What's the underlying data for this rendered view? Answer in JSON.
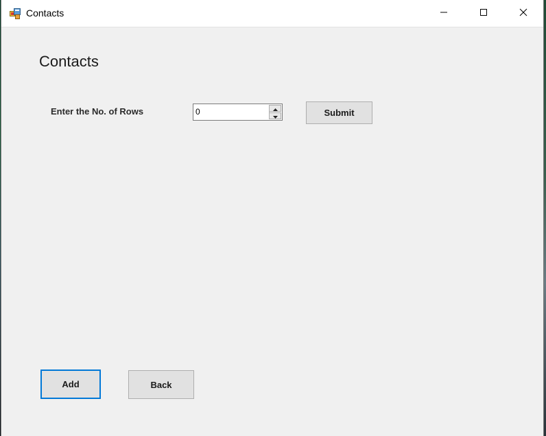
{
  "window": {
    "title": "Contacts",
    "app_icon": "app-form-icon",
    "controls": {
      "minimize": "minimize-icon",
      "maximize": "maximize-icon",
      "close": "close-icon"
    }
  },
  "form": {
    "heading": "Contacts",
    "rows_label": "Enter the No. of Rows",
    "rows_value": "0",
    "submit_label": "Submit",
    "add_label": "Add",
    "back_label": "Back"
  },
  "colors": {
    "window_bg": "#f0f0f0",
    "titlebar_bg": "#ffffff",
    "focus_border": "#0078d7",
    "button_bg": "#e1e1e1"
  }
}
